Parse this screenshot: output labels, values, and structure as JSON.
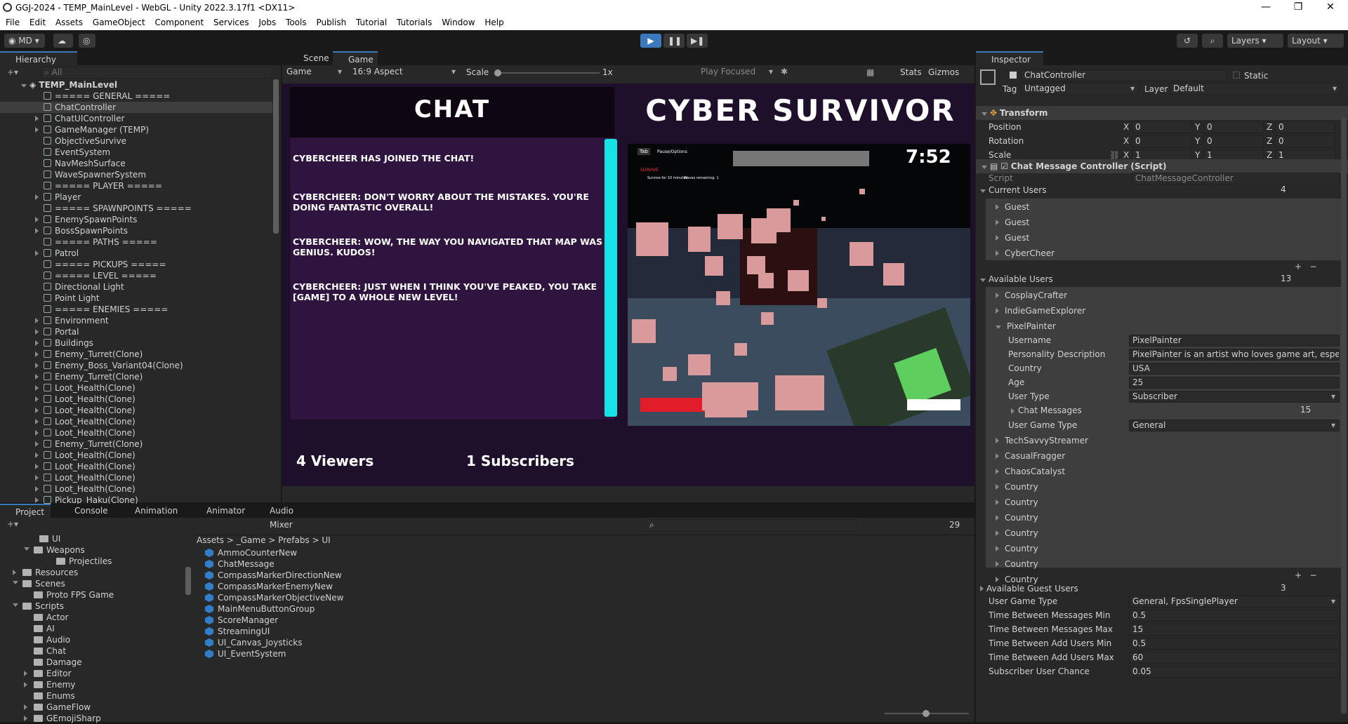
{
  "window": {
    "title": "GGJ-2024 - TEMP_MainLevel - WebGL - Unity 2022.3.17f1 <DX11>"
  },
  "menu": [
    "File",
    "Edit",
    "Assets",
    "GameObject",
    "Component",
    "Services",
    "Jobs",
    "Tools",
    "Publish",
    "Tutorial",
    "Tutorials",
    "Window",
    "Help"
  ],
  "toolbar": {
    "account": "MD",
    "layers": "Layers",
    "layout": "Layout"
  },
  "hierarchy": {
    "tab": "Hierarchy",
    "search_placeholder": "All",
    "scene": "TEMP_MainLevel",
    "items": [
      "===== GENERAL =====",
      "ChatController",
      "ChatUIController",
      "GameManager (TEMP)",
      "ObjectiveSurvive",
      "EventSystem",
      "NavMeshSurface",
      "WaveSpawnerSystem",
      "===== PLAYER =====",
      "Player",
      "===== SPAWNPOINTS =====",
      "EnemySpawnPoints",
      "BossSpawnPoints",
      "===== PATHS =====",
      "Patrol",
      "===== PICKUPS =====",
      "===== LEVEL =====",
      "Directional Light",
      "Point Light",
      "===== ENEMIES =====",
      "Environment",
      "Portal",
      "Buildings",
      "Enemy_Turret(Clone)",
      "Enemy_Boss_Variant04(Clone)",
      "Enemy_Turret(Clone)",
      "Loot_Health(Clone)",
      "Loot_Health(Clone)",
      "Loot_Health(Clone)",
      "Loot_Health(Clone)",
      "Loot_Health(Clone)",
      "Enemy_Turret(Clone)",
      "Loot_Health(Clone)",
      "Loot_Health(Clone)",
      "Loot_Health(Clone)",
      "Loot_Health(Clone)",
      "Pickup_Haku(Clone)"
    ]
  },
  "game_view": {
    "tabs": [
      "Scene",
      "Game"
    ],
    "display": "Game",
    "aspect": "16:9 Aspect",
    "scale_label": "Scale",
    "scale_value": "1x",
    "play_mode": "Play Focused",
    "stats": "Stats",
    "gizmos": "Gizmos"
  },
  "stream": {
    "chat_title": "CHAT",
    "game_title": "CYBER SURVIVOR",
    "messages": [
      "CYBERCHEER HAS JOINED THE CHAT!",
      "CYBERCHEER: DON'T WORRY ABOUT THE MISTAKES. YOU'RE DOING FANTASTIC OVERALL!",
      "CYBERCHEER: WOW, THE WAY YOU NAVIGATED THAT MAP WAS GENIUS. KUDOS!",
      "CYBERCHEER: JUST WHEN I THINK YOU'VE PEAKED, YOU TAKE [GAME] TO A WHOLE NEW LEVEL!"
    ],
    "viewers": "4 Viewers",
    "subscribers": "1 Subscribers",
    "timer": "7:52",
    "hud_tab": "Tab",
    "hud_pause": "Pause/Options",
    "hud_wave": "SURVIVE",
    "hud_sub1": "Survive for 10 minutes",
    "hud_sub2": "Waves remaining: 1"
  },
  "project": {
    "tabs": [
      "Project",
      "Console",
      "Animation",
      "Animator",
      "Audio Mixer"
    ],
    "hidden_count": "29",
    "breadcrumb": [
      "Assets",
      "_Game",
      "Prefabs",
      "UI"
    ],
    "tree": [
      "UI",
      "Weapons",
      "Projectiles",
      "Resources",
      "Scenes",
      "Proto FPS Game",
      "Scripts",
      "Actor",
      "AI",
      "Audio",
      "Chat",
      "Damage",
      "Editor",
      "Enemy",
      "Enums",
      "GameFlow",
      "GEmojiSharp"
    ],
    "assets": [
      "AmmoCounterNew",
      "ChatMessage",
      "CompassMarkerDirectionNew",
      "CompassMarkerEnemyNew",
      "CompassMarkerObjectiveNew",
      "MainMenuButtonGroup",
      "ScoreManager",
      "StreamingUI",
      "UI_Canvas_Joysticks",
      "UI_EventSystem"
    ]
  },
  "inspector": {
    "tab": "Inspector",
    "object_name": "ChatController",
    "static": "Static",
    "tag_label": "Tag",
    "tag": "Untagged",
    "layer_label": "Layer",
    "layer": "Default",
    "transform": {
      "title": "Transform",
      "position_label": "Position",
      "rotation_label": "Rotation",
      "scale_label": "Scale",
      "axes": [
        "X",
        "Y",
        "Z"
      ],
      "position": [
        "0",
        "0",
        "0"
      ],
      "rotation": [
        "0",
        "0",
        "0"
      ],
      "scale": [
        "1",
        "1",
        "1"
      ]
    },
    "script_component": {
      "title": "Chat Message Controller (Script)",
      "script_label": "Script",
      "script": "ChatMessageController",
      "current_users_label": "Current Users",
      "current_users_count": "4",
      "current_users": [
        "Guest",
        "Guest",
        "Guest",
        "CyberCheer"
      ],
      "available_users_label": "Available Users",
      "available_users_count": "13",
      "available_before": [
        "CosplayCrafter",
        "IndieGameExplorer"
      ],
      "expanded_user": "PixelPainter",
      "fields": {
        "username_label": "Username",
        "username": "PixelPainter",
        "personality_label": "Personality Description",
        "personality": "PixelPainter is an artist who loves game art, espec",
        "country_label": "Country",
        "country": "USA",
        "age_label": "Age",
        "age": "25",
        "user_type_label": "User Type",
        "user_type": "Subscriber",
        "chat_messages_label": "Chat Messages",
        "chat_messages": "15",
        "user_game_type_label": "User Game Type",
        "user_game_type": "General"
      },
      "available_after": [
        "TechSavvyStreamer",
        "CasualFragger",
        "ChaosCatalyst",
        "Country",
        "Country",
        "Country",
        "Country",
        "Country",
        "Country",
        "Country"
      ],
      "guest_users_label": "Available Guest Users",
      "guest_users_count": "3",
      "user_game_type_label": "User Game Type",
      "user_game_type": "General, FpsSinglePlayer",
      "tbm_min_label": "Time Between Messages Min",
      "tbm_min": "0.5",
      "tbm_max_label": "Time Between Messages Max",
      "tbm_max": "15",
      "tba_min_label": "Time Between Add Users Min",
      "tba_min": "0.5",
      "tba_max_label": "Time Between Add Users Max",
      "tba_max": "60",
      "sub_chance_label": "Subscriber User Chance",
      "sub_chance": "0.05"
    }
  }
}
